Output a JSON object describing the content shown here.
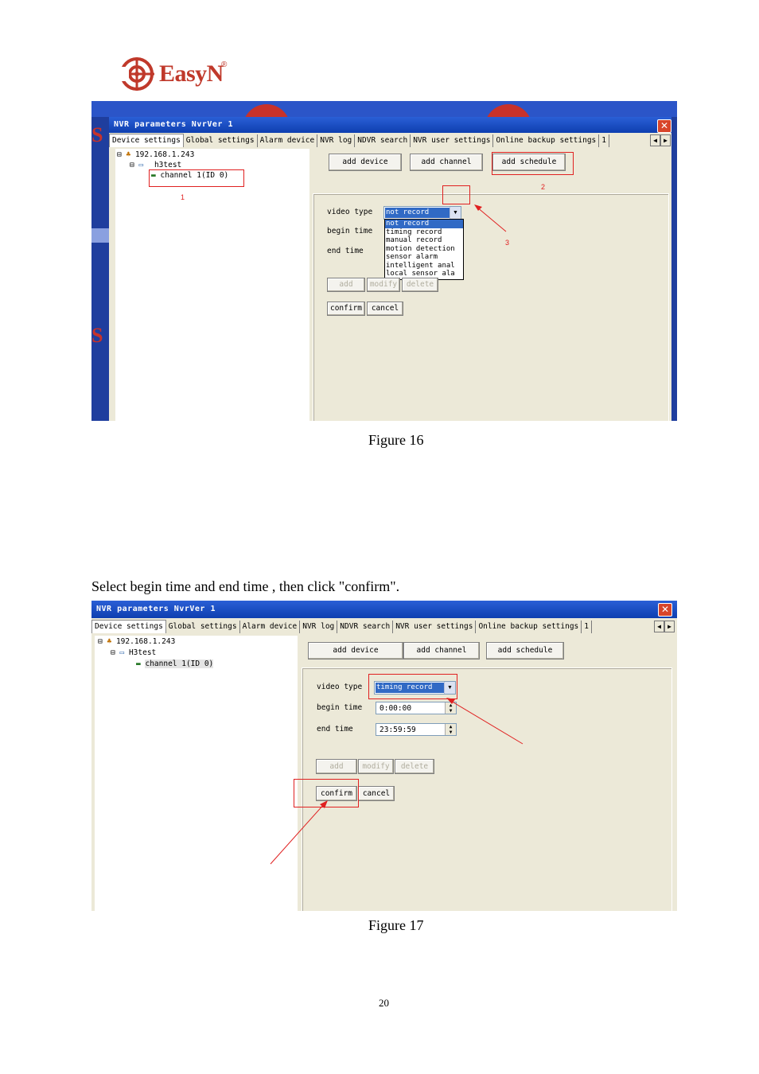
{
  "brand": {
    "name": "EasyN",
    "registered": "®"
  },
  "figure16": {
    "window_title": "NVR parameters NvrVer 1",
    "tabs": [
      "Device settings",
      "Global settings",
      "Alarm device",
      "NVR log",
      "NDVR search",
      "NVR user settings",
      "Online backup settings",
      "1"
    ],
    "tree": {
      "root": "192.168.1.243",
      "group": "h3test",
      "channel": "channel 1(ID 0)"
    },
    "buttons": {
      "add_device": "add device",
      "add_channel": "add channel",
      "add_schedule": "add schedule"
    },
    "form": {
      "video_type_label": "video type",
      "begin_time_label": "begin time",
      "end_time_label": "end time",
      "video_type_value": "not record"
    },
    "dropdown_options": [
      "not record",
      "timing record",
      "manual record",
      "motion detection",
      "sensor alarm",
      "intelligent anal",
      "local sensor ala"
    ],
    "action_buttons": {
      "add": "add",
      "modify": "modify",
      "delete": "delete",
      "confirm": "confirm",
      "cancel": "cancel"
    },
    "annotations": [
      "1",
      "2",
      "3"
    ],
    "caption": "Figure 16"
  },
  "instruction": "Select begin time and end time , then click \"confirm\".",
  "figure17": {
    "window_title": "NVR parameters NvrVer 1",
    "tabs": [
      "Device settings",
      "Global settings",
      "Alarm device",
      "NVR log",
      "NDVR search",
      "NVR user settings",
      "Online backup settings",
      "1"
    ],
    "tree": {
      "root": "192.168.1.243",
      "group": "H3test",
      "channel": "channel 1(ID 0)"
    },
    "buttons": {
      "add_device": "add device",
      "add_channel": "add channel",
      "add_schedule": "add schedule"
    },
    "form": {
      "video_type_label": "video type",
      "begin_time_label": "begin time",
      "end_time_label": "end time",
      "video_type_value": "timing record",
      "begin_time_value": "0:00:00",
      "end_time_value": "23:59:59"
    },
    "action_buttons": {
      "add": "add",
      "modify": "modify",
      "delete": "delete",
      "confirm": "confirm",
      "cancel": "cancel"
    },
    "caption": "Figure 17"
  },
  "page_number": "20",
  "colors": {
    "annotation": "#e02020",
    "brand": "#c0392b",
    "xp_face": "#ece9d8",
    "title_blue": "#0e3fb0"
  },
  "icons": [
    "easyn-logo-icon",
    "close-icon",
    "network-icon",
    "device-icon",
    "channel-icon",
    "dropdown-arrow-icon",
    "spin-arrows-icon",
    "annotation-arrow-icon"
  ]
}
